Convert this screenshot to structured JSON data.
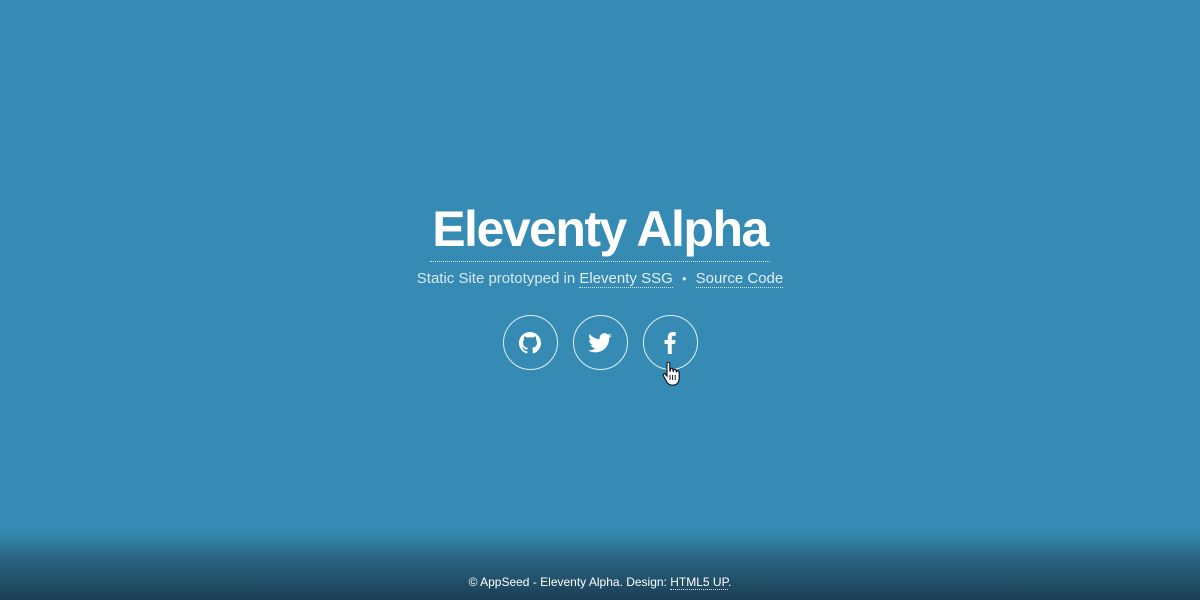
{
  "colors": {
    "background": "#358bb3",
    "footer_shadow": "#1b3f55",
    "text": "#ffffff"
  },
  "header": {
    "title": "Eleventy Alpha",
    "subtitle_prefix": "Static Site prototyped in",
    "eleventy_link": "Eleventy SSG",
    "separator": "•",
    "source_link": "Source Code"
  },
  "social": [
    {
      "name": "github",
      "icon": "github-icon"
    },
    {
      "name": "twitter",
      "icon": "twitter-icon"
    },
    {
      "name": "facebook",
      "icon": "facebook-icon"
    }
  ],
  "footer": {
    "text": "© AppSeed - Eleventy Alpha. Design:",
    "design_link": "HTML5 UP",
    "trailing": "."
  }
}
